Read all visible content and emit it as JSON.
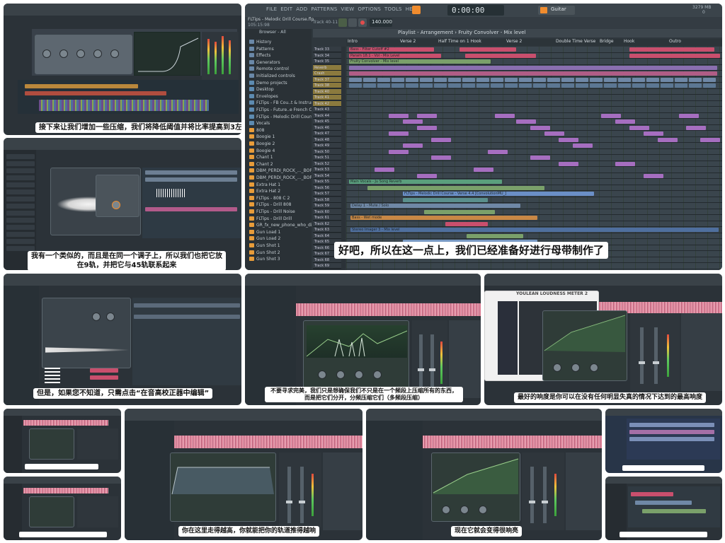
{
  "captions": {
    "p1": "接下来让我们增加一些压缩，我们将降低阈值并将比率提高到3左右",
    "p2": "我有一个类似的，而且是在同一个调子上，所以我们也把它放在9轨，并把它与45轨联系起来",
    "p3": "好吧，所以在这一点上，我们已经准备好进行母带制作了",
    "p4": "但是，如果您不知道，只需点击“在音高校正器中编辑”",
    "p5": "不要寻求完美，我们只是想确保我们不只是在一个频段上压缩所有的东西，而是把它们分开，分频压缩它们（多频段压缩）",
    "p6": "最好的响度是你可以在没有任何明显失真的情况下达到的最高响度",
    "p9": "你在这里走得越高，你就能把你的轨道推得越响",
    "p10": "现在它就会变得很响亮"
  },
  "main": {
    "menu": [
      "FILE",
      "EDIT",
      "ADD",
      "PATTERNS",
      "VIEW",
      "OPTIONS",
      "TOOLS",
      "HELP"
    ],
    "project_title": "FLTips - Melodic Drill Course.flp",
    "project_time": "105:15:98",
    "track_label": "Track 40-11",
    "tempo": "140.000",
    "time_display": "0:00:00",
    "plugin_name": "Guitar",
    "cpu_ram": "3279 MB",
    "cpu_num": "0",
    "playlist_title": "Playlist - Arrangement › Fruity Convolver - Mix level",
    "browser_title": "Browser - All",
    "browser_items": [
      "History",
      "Patterns",
      "Effects",
      "Generators",
      "Remote control",
      "Initialized controls",
      "Demo projects",
      "Desktop",
      "Envelopes",
      "FLTips - FB Cou..t & Instruments",
      "FLTips - Future..e French Course",
      "FLTips - Melodic Drill Course",
      "Vocals",
      "808",
      "Boogie 1",
      "Boogie 2",
      "Boogie 4",
      "Chant 1",
      "Chant 2",
      "DBM_PERDI_ROCK_..._BOPM_F-MINOR",
      "DBM_PERDI_ROCK_..._BOPM_F-MINOR",
      "Extra Hat 1",
      "Extra Hat 2",
      "FLTips - 808 C 2",
      "FLTips - Drill 808",
      "FLTips - Drill Noise",
      "FLTips - Drill Drill",
      "GR_fx_new_phone_who_dis_Climix",
      "Gun Load 1",
      "Gun Load 2",
      "Gun Shot 1",
      "Gun Shot 2",
      "Gun Shot 3"
    ],
    "markers": [
      "Intro",
      "Verse 2",
      "Half Time on 1 Hook",
      "Verse 2",
      "Double Time Verse",
      "Bridge",
      "Hook",
      "Outro"
    ],
    "tracks": [
      "Track 33",
      "Track 34",
      "Track 35",
      "Reverb",
      "Crash",
      "Track 37",
      "Track 38",
      "Track 40",
      "Track 41",
      "Track 42",
      "Track 43",
      "Track 44",
      "Track 45",
      "Track 46",
      "Track 47",
      "Track 48",
      "Track 49",
      "Track 50",
      "Track 51",
      "Track 52",
      "Track 53",
      "Track 54",
      "Track 55",
      "Track 56",
      "Track 57",
      "Track 58",
      "Track 59",
      "Track 60",
      "Track 61",
      "Track 62",
      "Track 63",
      "Track 64",
      "Track 65",
      "Track 66",
      "Track 67",
      "Track 68",
      "Track 69"
    ],
    "clip_labels": {
      "bass_filter": "Bass - Filter Cutoff #2",
      "param_volume": "Param 18.1 - Vol - Mix Level",
      "fruity_conv": "Fruity Convolver - Mix level",
      "vocals": "Main Vocals - Ju Song Reverb",
      "delay": "Delay 1 - Mute / Solo",
      "bass_wet": "Bass - Wet mode",
      "drill_course": "FLTips - Melodic Drill Course - Verse 4.4 [ConvolutionMU_]",
      "stereo": "Stereo Imager 3 - Mix level"
    },
    "loudness_meter": "YOULEAN LOUDNESS METER 2"
  },
  "colors": {
    "bg_panel": "#2b3238",
    "accent_orange": "#f08c2e",
    "clip_red": "#c94f6d",
    "clip_green": "#7aa06a",
    "clip_blue": "#6f88a6",
    "wave_pink": "#d66f88"
  }
}
